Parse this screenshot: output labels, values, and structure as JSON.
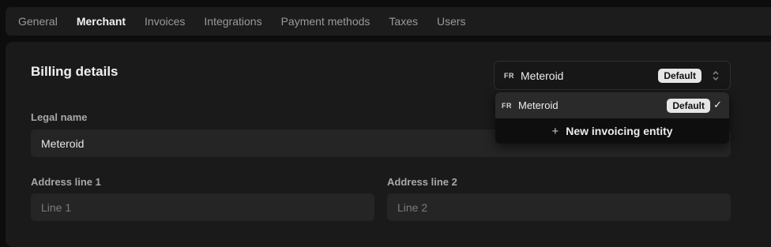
{
  "tabs": [
    {
      "label": "General",
      "active": false
    },
    {
      "label": "Merchant",
      "active": true
    },
    {
      "label": "Invoices",
      "active": false
    },
    {
      "label": "Integrations",
      "active": false
    },
    {
      "label": "Payment methods",
      "active": false
    },
    {
      "label": "Taxes",
      "active": false
    },
    {
      "label": "Users",
      "active": false
    }
  ],
  "billing": {
    "title": "Billing details",
    "legal_name_label": "Legal name",
    "legal_name_value": "Meteroid",
    "address1_label": "Address line 1",
    "address1_placeholder": "Line 1",
    "address2_label": "Address line 2",
    "address2_placeholder": "Line 2"
  },
  "entity_select": {
    "country_code": "FR",
    "name": "Meteroid",
    "badge": "Default",
    "icon": "chevron-up-down-icon"
  },
  "entity_dropdown": {
    "option": {
      "country_code": "FR",
      "name": "Meteroid",
      "badge": "Default",
      "check": "✓"
    },
    "new_plus": "+",
    "new_label": "New invoicing entity"
  }
}
